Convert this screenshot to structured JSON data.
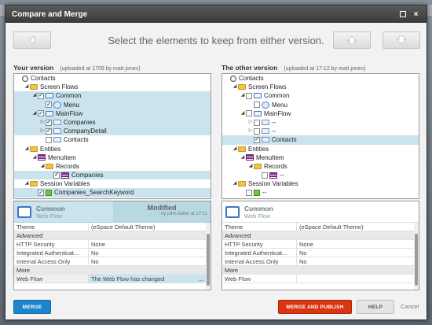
{
  "window": {
    "title": "Compare and Merge",
    "maximize_icon": "maximize-icon",
    "close_glyph": "×"
  },
  "header": {
    "instruction": "Select the elements to keep from either version.",
    "back_icon": "arrow-left-icon",
    "forward_icon": "arrow-right-icon",
    "up_icon": "arrow-up-icon",
    "down_icon": "arrow-down-icon"
  },
  "left": {
    "title": "Your version",
    "meta": "(uploaded at 1709 by matt.jones)",
    "tree": [
      {
        "label": "Contacts",
        "depth": 0,
        "expander": "",
        "checkbox": false,
        "checked": false,
        "icon": "root",
        "selected": false
      },
      {
        "label": "Screen Flows",
        "depth": 1,
        "expander": "◢",
        "checkbox": false,
        "checked": false,
        "icon": "folder",
        "selected": false
      },
      {
        "label": "Common",
        "depth": 2,
        "expander": "◢",
        "checkbox": true,
        "checked": true,
        "icon": "flow",
        "selected": true
      },
      {
        "label": "Menu",
        "depth": 3,
        "expander": "",
        "checkbox": true,
        "checked": true,
        "icon": "menu",
        "selected": true
      },
      {
        "label": "MainFlow",
        "depth": 2,
        "expander": "◢",
        "checkbox": true,
        "checked": true,
        "icon": "flow",
        "selected": true
      },
      {
        "label": "Companies",
        "depth": 3,
        "expander": "▷",
        "checkbox": true,
        "checked": true,
        "icon": "screen",
        "selected": true
      },
      {
        "label": "CompanyDetail",
        "depth": 3,
        "expander": "▷",
        "checkbox": true,
        "checked": true,
        "icon": "screen",
        "selected": true
      },
      {
        "label": "Contacts",
        "depth": 3,
        "expander": "",
        "checkbox": true,
        "checked": false,
        "icon": "screen",
        "selected": false
      },
      {
        "label": "Entities",
        "depth": 1,
        "expander": "◢",
        "checkbox": false,
        "checked": false,
        "icon": "folder",
        "selected": false
      },
      {
        "label": "MenuItem",
        "depth": 2,
        "expander": "◢",
        "checkbox": false,
        "checked": false,
        "icon": "entity",
        "selected": false
      },
      {
        "label": "Records",
        "depth": 3,
        "expander": "◢",
        "checkbox": false,
        "checked": false,
        "icon": "folder",
        "selected": false
      },
      {
        "label": "Companies",
        "depth": 4,
        "expander": "",
        "checkbox": true,
        "checked": true,
        "icon": "entity",
        "selected": true
      },
      {
        "label": "Session Variables",
        "depth": 1,
        "expander": "◢",
        "checkbox": false,
        "checked": false,
        "icon": "folder",
        "selected": false
      },
      {
        "label": "Companies_SearchKeyword",
        "depth": 2,
        "expander": "",
        "checkbox": true,
        "checked": true,
        "icon": "var",
        "selected": true
      }
    ],
    "props_header": {
      "title": "Common",
      "subtitle": "Web Flow",
      "status": "Modified",
      "by": "by john.baker at 17:11"
    },
    "props": [
      {
        "type": "row",
        "key": "Theme",
        "value": "(eSpace Default Theme)",
        "hl": false
      },
      {
        "type": "sec",
        "key": "Advanced"
      },
      {
        "type": "row",
        "key": "HTTP Security",
        "value": "None",
        "hl": false
      },
      {
        "type": "row",
        "key": "Integrated Authenticat...",
        "value": "No",
        "hl": false
      },
      {
        "type": "row",
        "key": "Internal Access Only",
        "value": "No",
        "hl": false
      },
      {
        "type": "sec",
        "key": "More"
      },
      {
        "type": "row",
        "key": "Web Flow",
        "value": "The Web Flow has changed",
        "hl": true,
        "ellipsis": "..."
      }
    ]
  },
  "right": {
    "title": "The other version",
    "meta": "(uploaded at 17:12 by matt.jones)",
    "tree": [
      {
        "label": "Contacts",
        "depth": 0,
        "expander": "",
        "checkbox": false,
        "checked": false,
        "icon": "root",
        "selected": false
      },
      {
        "label": "Screen Flows",
        "depth": 1,
        "expander": "◢",
        "checkbox": false,
        "checked": false,
        "icon": "folder",
        "selected": false
      },
      {
        "label": "Common",
        "depth": 2,
        "expander": "◢",
        "checkbox": true,
        "checked": false,
        "icon": "flow",
        "selected": false
      },
      {
        "label": "Menu",
        "depth": 3,
        "expander": "",
        "checkbox": true,
        "checked": false,
        "icon": "menu",
        "selected": false
      },
      {
        "label": "MainFlow",
        "depth": 2,
        "expander": "◢",
        "checkbox": true,
        "checked": false,
        "icon": "flow",
        "selected": false
      },
      {
        "label": "--",
        "depth": 3,
        "expander": "▷",
        "checkbox": true,
        "checked": false,
        "icon": "screen",
        "selected": false
      },
      {
        "label": "--",
        "depth": 3,
        "expander": "▷",
        "checkbox": true,
        "checked": false,
        "icon": "screen",
        "selected": false
      },
      {
        "label": "Contacts",
        "depth": 3,
        "expander": "",
        "checkbox": true,
        "checked": true,
        "icon": "screen",
        "selected": true
      },
      {
        "label": "Entities",
        "depth": 1,
        "expander": "◢",
        "checkbox": false,
        "checked": false,
        "icon": "folder",
        "selected": false
      },
      {
        "label": "MenuItem",
        "depth": 2,
        "expander": "◢",
        "checkbox": false,
        "checked": false,
        "icon": "entity",
        "selected": false
      },
      {
        "label": "Records",
        "depth": 3,
        "expander": "◢",
        "checkbox": false,
        "checked": false,
        "icon": "folder",
        "selected": false
      },
      {
        "label": "--",
        "depth": 4,
        "expander": "",
        "checkbox": true,
        "checked": false,
        "icon": "entity",
        "selected": false
      },
      {
        "label": "Session Variables",
        "depth": 1,
        "expander": "◢",
        "checkbox": false,
        "checked": false,
        "icon": "folder",
        "selected": false
      },
      {
        "label": "--",
        "depth": 2,
        "expander": "",
        "checkbox": true,
        "checked": false,
        "icon": "var",
        "selected": false
      }
    ],
    "props_header": {
      "title": "Common",
      "subtitle": "Web Flow"
    },
    "props": [
      {
        "type": "row",
        "key": "Theme",
        "value": "(eSpace Default Theme)",
        "hl": false
      },
      {
        "type": "sec",
        "key": "Advanced"
      },
      {
        "type": "row",
        "key": "HTTP Security",
        "value": "None",
        "hl": false
      },
      {
        "type": "row",
        "key": "Integrated Authenticat...",
        "value": "No",
        "hl": false
      },
      {
        "type": "row",
        "key": "Internal Access Only",
        "value": "No",
        "hl": false
      },
      {
        "type": "sec",
        "key": "More"
      },
      {
        "type": "row",
        "key": "Web Flow",
        "value": "",
        "hl": false
      }
    ]
  },
  "footer": {
    "merge_label": "MERGE",
    "merge_publish_label": "MERGE AND PUBLISH",
    "help_label": "HELP",
    "cancel_label": "Cancel"
  }
}
